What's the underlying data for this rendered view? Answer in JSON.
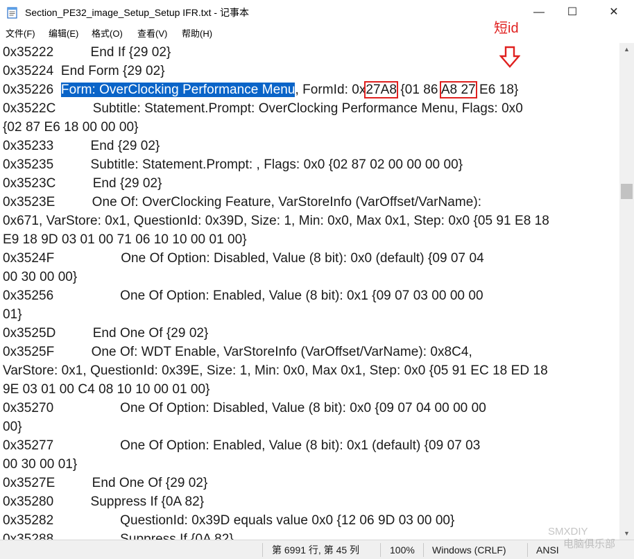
{
  "window": {
    "title": "Section_PE32_image_Setup_Setup IFR.txt - 记事本",
    "minimize_glyph": "—",
    "maximize_glyph": "☐",
    "close_glyph": "✕"
  },
  "menu": [
    "文件(F)",
    "编辑(E)",
    "格式(O)",
    "查看(V)",
    "帮助(H)"
  ],
  "annotation": {
    "label": "短id",
    "color": "#e0201f",
    "arrow_icon": "down-arrow-icon"
  },
  "selection_color": "#0a64c8",
  "lines": [
    [
      "0x35222          End If {29 02}"
    ],
    [
      "0x35224  End Form {29 02}"
    ],
    [
      "0x35226  ",
      "Form: OverClocking Performance Menu",
      ", FormId: 0x",
      "27A8",
      " {01 86 ",
      "A8 27",
      " E6 18}"
    ],
    [
      "0x3522C          Subtitle: Statement.Prompt: OverClocking Performance Menu, Flags: 0x0"
    ],
    [
      "{02 87 E6 18 00 00 00}"
    ],
    [
      "0x35233          End {29 02}"
    ],
    [
      "0x35235          Subtitle: Statement.Prompt: , Flags: 0x0 {02 87 02 00 00 00 00}"
    ],
    [
      "0x3523C          End {29 02}"
    ],
    [
      "0x3523E          One Of: OverClocking Feature, VarStoreInfo (VarOffset/VarName):"
    ],
    [
      "0x671, VarStore: 0x1, QuestionId: 0x39D, Size: 1, Min: 0x0, Max 0x1, Step: 0x0 {05 91 E8 18"
    ],
    [
      "E9 18 9D 03 01 00 71 06 10 10 00 01 00}"
    ],
    [
      "0x3524F                  One Of Option: Disabled, Value (8 bit): 0x0 (default) {09 07 04"
    ],
    [
      "00 30 00 00}"
    ],
    [
      "0x35256                  One Of Option: Enabled, Value (8 bit): 0x1 {09 07 03 00 00 00"
    ],
    [
      "01}"
    ],
    [
      "0x3525D          End One Of {29 02}"
    ],
    [
      "0x3525F          One Of: WDT Enable, VarStoreInfo (VarOffset/VarName): 0x8C4,"
    ],
    [
      "VarStore: 0x1, QuestionId: 0x39E, Size: 1, Min: 0x0, Max 0x1, Step: 0x0 {05 91 EC 18 ED 18"
    ],
    [
      "9E 03 01 00 C4 08 10 10 00 01 00}"
    ],
    [
      "0x35270                  One Of Option: Disabled, Value (8 bit): 0x0 {09 07 04 00 00 00"
    ],
    [
      "00}"
    ],
    [
      "0x35277                  One Of Option: Enabled, Value (8 bit): 0x1 (default) {09 07 03"
    ],
    [
      "00 30 00 01}"
    ],
    [
      "0x3527E          End One Of {29 02}"
    ],
    [
      "0x35280          Suppress If {0A 82}"
    ],
    [
      "0x35282                  QuestionId: 0x39D equals value 0x0 {12 06 9D 03 00 00}"
    ],
    [
      "0x35288                  Suppress If {0A 82}"
    ]
  ],
  "status": {
    "position": "第 6991 行, 第 45 列",
    "zoom": "100%",
    "line_ending": "Windows (CRLF)",
    "encoding": "ANSI"
  },
  "watermark": {
    "line1": "SMXDIY",
    "line2": "电脑俱乐部"
  }
}
